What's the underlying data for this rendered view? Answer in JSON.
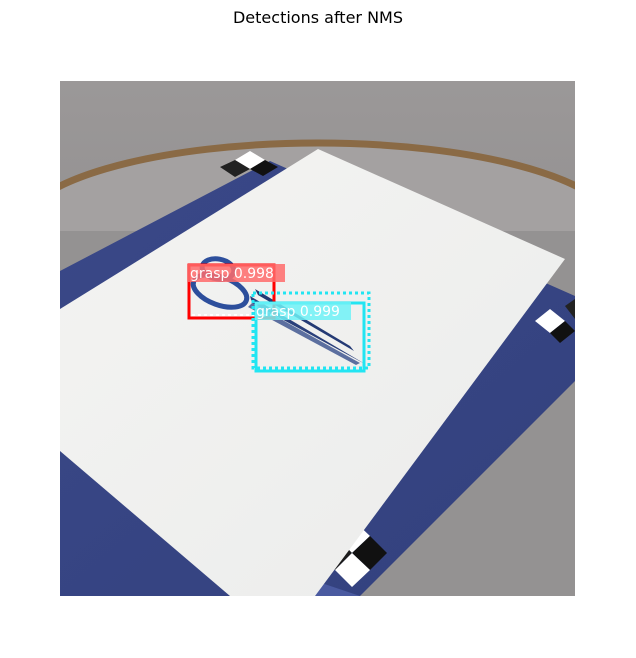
{
  "figure": {
    "title": "Detections after NMS"
  },
  "detections": [
    {
      "label": "grasp 0.998",
      "color": "#ff0000",
      "label_bg": "#ff6b6b"
    },
    {
      "label": "grasp 0.999",
      "color": "#22e5f2",
      "label_bg": "#6ef2f7"
    }
  ],
  "scene": {
    "description_colors": {
      "background": "#8f8d8e",
      "table_blue": "#3b4a8c",
      "paper": "#f2f3f1",
      "rim": "#8a6a45"
    }
  }
}
